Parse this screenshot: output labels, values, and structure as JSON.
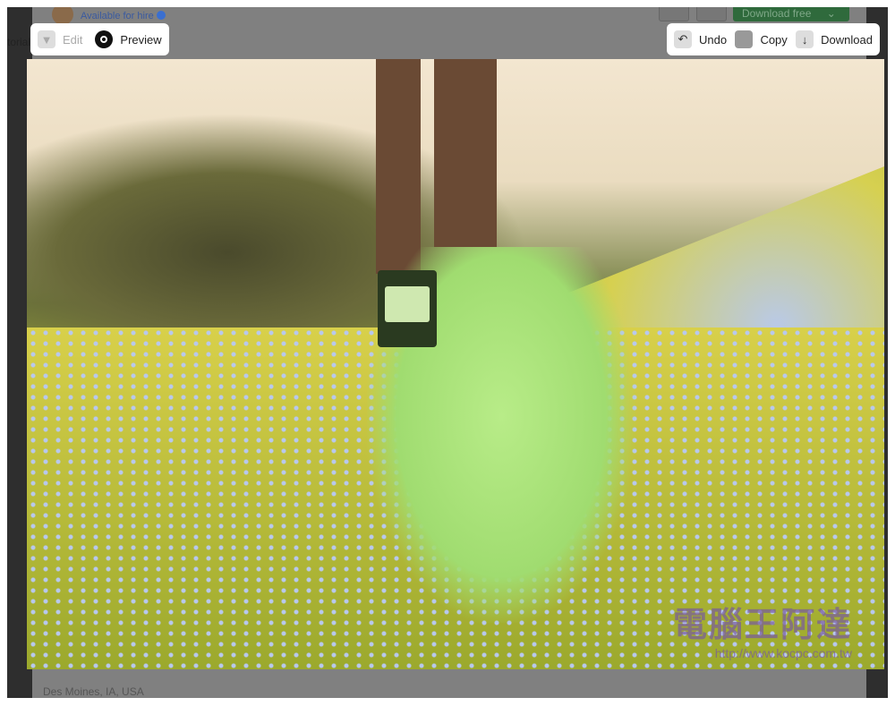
{
  "header": {
    "availability": "Available for hire",
    "tab_partial": "torial",
    "download_free": "Download free"
  },
  "left_toolbar": {
    "edit": "Edit",
    "preview": "Preview"
  },
  "right_toolbar": {
    "undo": "Undo",
    "copy": "Copy",
    "download": "Download"
  },
  "photo": {
    "watermark_text": "電腦王阿達",
    "watermark_url": "http://www.kocpc.com.tw"
  },
  "footer": {
    "location": "Des Moines, IA, USA"
  }
}
